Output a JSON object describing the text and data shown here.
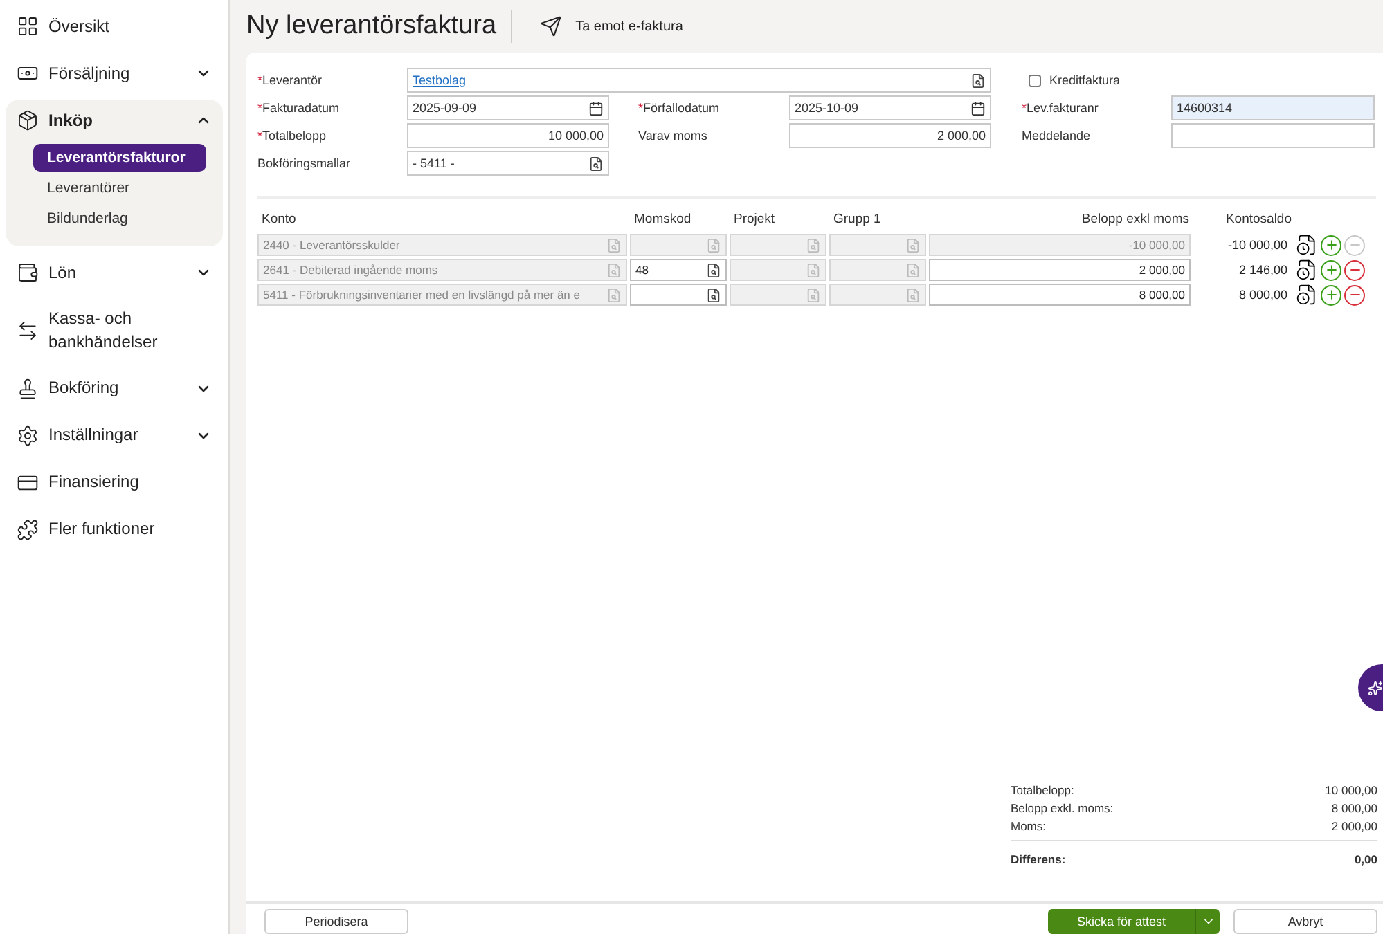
{
  "sidebar": {
    "items": [
      {
        "kind": "link",
        "label": "Översikt",
        "expanded": false
      },
      {
        "kind": "group",
        "label": "Försäljning",
        "expanded": false
      },
      {
        "kind": "group",
        "label": "Inköp",
        "expanded": true,
        "children": [
          {
            "label": "Leverantörsfakturor",
            "selected": true
          },
          {
            "label": "Leverantörer",
            "selected": false
          },
          {
            "label": "Bildunderlag",
            "selected": false
          }
        ]
      },
      {
        "kind": "group",
        "label": "Lön",
        "expanded": false
      },
      {
        "kind": "link",
        "label": "Kassa- och bankhändelser",
        "expanded": false
      },
      {
        "kind": "group",
        "label": "Bokföring",
        "expanded": false
      },
      {
        "kind": "group",
        "label": "Inställningar",
        "expanded": false
      },
      {
        "kind": "link",
        "label": "Finansiering",
        "expanded": false
      },
      {
        "kind": "link",
        "label": "Fler funktioner",
        "expanded": false
      }
    ]
  },
  "header": {
    "title": "Ny leverantörsfaktura",
    "action": "Ta emot e-faktura"
  },
  "form": {
    "supplier": {
      "required_mark": "*",
      "label": "Leverantör",
      "value": "Testbolag"
    },
    "credit_invoice": {
      "label": "Kreditfaktura",
      "checked": false
    },
    "invoice_date": {
      "required_mark": "*",
      "label": "Fakturadatum",
      "value": "2025-09-09"
    },
    "due_date": {
      "required_mark": "*",
      "label": "Förfallodatum",
      "value": "2025-10-09"
    },
    "supplier_invoice_no": {
      "required_mark": "*",
      "label": "Lev.fakturanr",
      "value": "14600314"
    },
    "total": {
      "required_mark": "*",
      "label": "Totalbelopp",
      "value": "10 000,00"
    },
    "vat": {
      "label": "Varav moms",
      "value": "2 000,00"
    },
    "message": {
      "label": "Meddelande"
    },
    "template": {
      "label": "Bokföringsmallar",
      "value": "- 5411 -"
    }
  },
  "table": {
    "columns": [
      "Konto",
      "Momskod",
      "Projekt",
      "Grupp 1",
      "Belopp exkl moms",
      "Kontosaldo"
    ],
    "rows": [
      {
        "account": "2440 - Leverantörsskulder",
        "vat_code": "",
        "vat_disabled": true,
        "amount": "-10 000,00",
        "amount_disabled": true,
        "balance": "-10 000,00",
        "remove_disabled": true
      },
      {
        "account": "2641 - Debiterad ingående moms",
        "vat_code": "48",
        "vat_disabled": false,
        "amount": "2 000,00",
        "amount_disabled": false,
        "balance": "2 146,00",
        "remove_disabled": false
      },
      {
        "account": "5411 - Förbrukningsinventarier med en livslängd på mer än e",
        "vat_code": "",
        "vat_disabled": false,
        "amount": "8 000,00",
        "amount_disabled": false,
        "balance": "8 000,00",
        "remove_disabled": false
      }
    ]
  },
  "summary": {
    "rows": [
      {
        "label": "Totalbelopp:",
        "value": "10 000,00"
      },
      {
        "label": "Belopp exkl. moms:",
        "value": "8 000,00"
      },
      {
        "label": "Moms:",
        "value": "2 000,00"
      }
    ],
    "difference": {
      "label": "Differens:",
      "value": "0,00"
    }
  },
  "footer": {
    "left_button": "Periodisera",
    "primary_button": "Skicka för attest",
    "cancel_button": "Avbryt"
  }
}
